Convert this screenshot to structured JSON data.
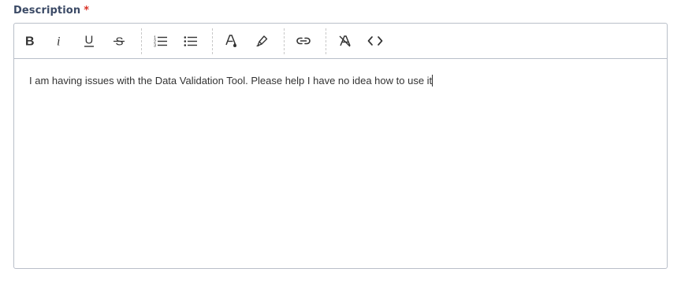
{
  "field": {
    "label": "Description",
    "required_marker": "*"
  },
  "toolbar": {
    "buttons": [
      {
        "name": "bold",
        "icon": "bold-icon"
      },
      {
        "name": "italic",
        "icon": "italic-icon"
      },
      {
        "name": "underline",
        "icon": "underline-icon"
      },
      {
        "name": "strikethrough",
        "icon": "strikethrough-icon"
      },
      {
        "name": "ordered-list",
        "icon": "ordered-list-icon"
      },
      {
        "name": "bullet-list",
        "icon": "bullet-list-icon"
      },
      {
        "name": "text-color",
        "icon": "text-color-icon"
      },
      {
        "name": "highlight",
        "icon": "highlighter-icon"
      },
      {
        "name": "link",
        "icon": "link-icon"
      },
      {
        "name": "clear-format",
        "icon": "clear-format-icon"
      },
      {
        "name": "code-view",
        "icon": "code-icon"
      }
    ]
  },
  "editor": {
    "text": "I am having issues with the Data Validation Tool. Please help I have no idea how to use it"
  },
  "colors": {
    "label": "#3b4a66",
    "required": "#d93025",
    "border": "#b9bfc9",
    "text": "#333333"
  }
}
